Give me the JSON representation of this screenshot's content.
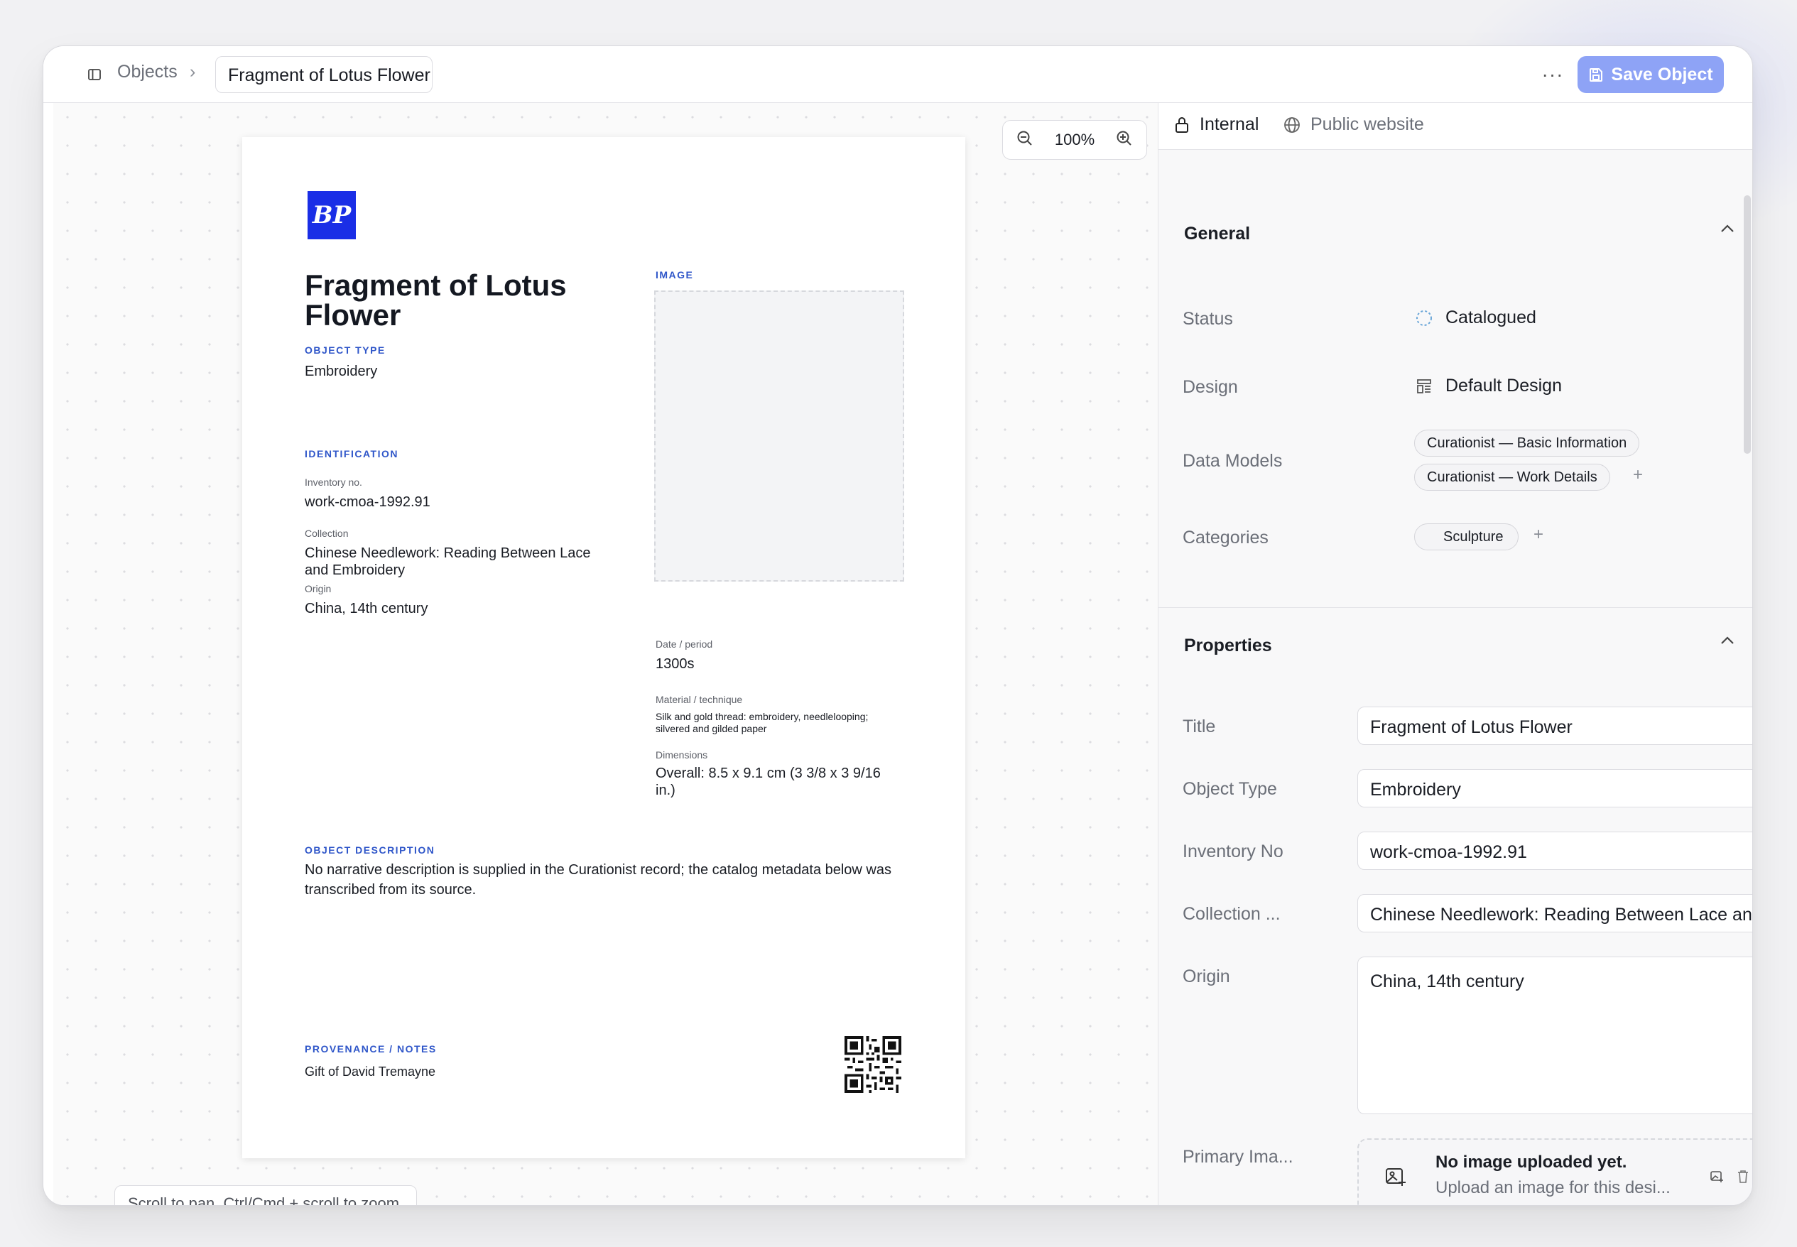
{
  "header": {
    "breadcrumb_root": "Objects",
    "breadcrumb_current": "Fragment of Lotus Flower",
    "more_label": "···",
    "save_label": "Save Object"
  },
  "canvas": {
    "zoom_level": "100%",
    "hint": "Scroll to pan. Ctrl/Cmd + scroll to zoom."
  },
  "document": {
    "logo_text": "BP",
    "title": "Fragment of Lotus Flower",
    "object_type_label": "OBJECT TYPE",
    "object_type": "Embroidery",
    "image_label": "IMAGE",
    "identification_label": "IDENTIFICATION",
    "inventory_label": "Inventory no.",
    "inventory_value": "work-cmoa-1992.91",
    "collection_label": "Collection",
    "collection_value": "Chinese Needlework: Reading Between Lace and Embroidery",
    "origin_label": "Origin",
    "origin_value": "China, 14th century",
    "date_label": "Date / period",
    "date_value": "1300s",
    "material_label": "Material / technique",
    "material_value": "Silk and gold thread: embroidery, needlelooping; silvered and gilded paper",
    "dimensions_label": "Dimensions",
    "dimensions_value": "Overall: 8.5 x 9.1 cm (3 3/8 x 3 9/16 in.)",
    "description_label": "OBJECT DESCRIPTION",
    "description_value": "No narrative description is supplied in the Curationist record; the catalog metadata below was transcribed from its source.",
    "provenance_label": "PROVENANCE / NOTES",
    "provenance_value": "Gift of David Tremayne"
  },
  "panel": {
    "tabs": [
      {
        "label": "Internal",
        "active": true
      },
      {
        "label": "Public website",
        "active": false
      }
    ],
    "general": {
      "heading": "General",
      "status_label": "Status",
      "status_value": "Catalogued",
      "design_label": "Design",
      "design_value": "Default Design",
      "data_models_label": "Data Models",
      "data_models": [
        "Curationist — Basic Information",
        "Curationist — Work Details"
      ],
      "categories_label": "Categories",
      "categories": [
        "Sculpture"
      ]
    },
    "properties": {
      "heading": "Properties",
      "title_label": "Title",
      "title_value": "Fragment of Lotus Flower",
      "object_type_label": "Object Type",
      "object_type_value": "Embroidery",
      "inventory_label": "Inventory No",
      "inventory_value": "work-cmoa-1992.91",
      "collection_label": "Collection ...",
      "collection_value": "Chinese Needlework: Reading Between Lace and Embroidery",
      "origin_label": "Origin",
      "origin_value": "China, 14th century",
      "primary_image_label": "Primary Ima...",
      "upload_title": "No image uploaded yet.",
      "upload_subtitle": "Upload an image for this desi..."
    }
  },
  "colors": {
    "accent": "#8ea3f6",
    "logo_blue": "#1a2ee6",
    "label_blue": "#2f56c9"
  }
}
